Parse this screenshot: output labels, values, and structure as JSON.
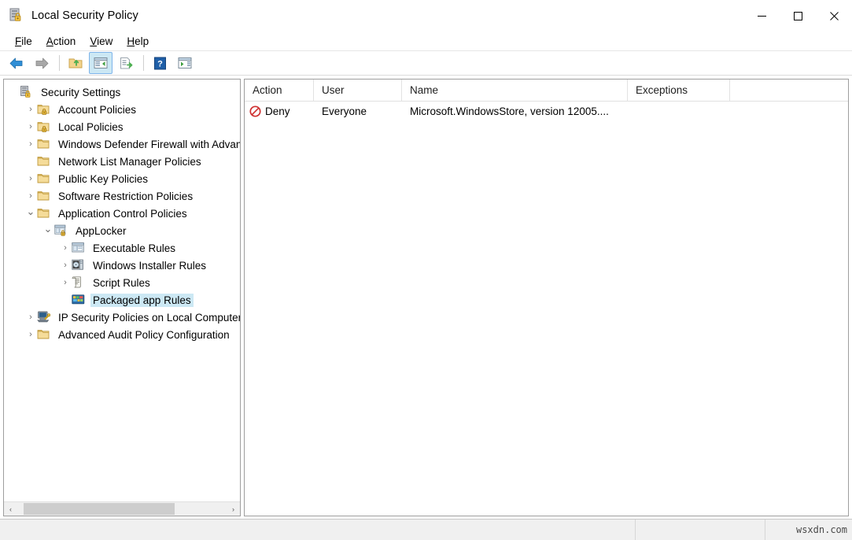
{
  "window": {
    "title": "Local Security Policy",
    "icon": "security-policy-icon",
    "minimize_label": "─",
    "maximize_label": "□",
    "close_label": "✕"
  },
  "menubar": {
    "items": [
      {
        "label": "File",
        "accel": "F"
      },
      {
        "label": "Action",
        "accel": "A"
      },
      {
        "label": "View",
        "accel": "V"
      },
      {
        "label": "Help",
        "accel": "H"
      }
    ]
  },
  "toolbar": {
    "buttons": [
      {
        "name": "back-button",
        "icon": "back-arrow-icon",
        "active": false
      },
      {
        "name": "forward-button",
        "icon": "forward-arrow-icon",
        "active": false
      },
      {
        "name": "up-one-level-button",
        "icon": "folder-up-icon",
        "active": false
      },
      {
        "name": "show-hide-console-tree-button",
        "icon": "console-tree-icon",
        "active": true
      },
      {
        "name": "export-list-button",
        "icon": "export-list-icon",
        "active": false
      },
      {
        "name": "help-button",
        "icon": "help-question-icon",
        "active": false
      },
      {
        "name": "show-hide-action-pane-button",
        "icon": "action-pane-icon",
        "active": false
      }
    ]
  },
  "tree": {
    "root_label": "Security Settings",
    "nodes": [
      {
        "label": "Security Settings",
        "icon": "security-policy-icon",
        "indent": 0,
        "chevron": "",
        "selected": false
      },
      {
        "label": "Account Policies",
        "icon": "folder-lock-icon",
        "indent": 1,
        "chevron": "›",
        "selected": false
      },
      {
        "label": "Local Policies",
        "icon": "folder-lock-icon",
        "indent": 1,
        "chevron": "›",
        "selected": false
      },
      {
        "label": "Windows Defender Firewall with Advanced Security",
        "icon": "folder-icon",
        "indent": 1,
        "chevron": "›",
        "selected": false
      },
      {
        "label": "Network List Manager Policies",
        "icon": "folder-icon",
        "indent": 1,
        "chevron": "",
        "selected": false
      },
      {
        "label": "Public Key Policies",
        "icon": "folder-icon",
        "indent": 1,
        "chevron": "›",
        "selected": false
      },
      {
        "label": "Software Restriction Policies",
        "icon": "folder-icon",
        "indent": 1,
        "chevron": "›",
        "selected": false
      },
      {
        "label": "Application Control Policies",
        "icon": "folder-icon",
        "indent": 1,
        "chevron": "⌄",
        "selected": false
      },
      {
        "label": "AppLocker",
        "icon": "applocker-icon",
        "indent": 2,
        "chevron": "⌄",
        "selected": false
      },
      {
        "label": "Executable Rules",
        "icon": "executable-rules-icon",
        "indent": 3,
        "chevron": "›",
        "selected": false
      },
      {
        "label": "Windows Installer Rules",
        "icon": "windows-installer-rules-icon",
        "indent": 3,
        "chevron": "›",
        "selected": false
      },
      {
        "label": "Script Rules",
        "icon": "script-rules-icon",
        "indent": 3,
        "chevron": "›",
        "selected": false
      },
      {
        "label": "Packaged app Rules",
        "icon": "packaged-app-rules-icon",
        "indent": 3,
        "chevron": "",
        "selected": true
      },
      {
        "label": "IP Security Policies on Local Computer",
        "icon": "ip-security-icon",
        "indent": 1,
        "chevron": "›",
        "selected": false
      },
      {
        "label": "Advanced Audit Policy Configuration",
        "icon": "folder-icon",
        "indent": 1,
        "chevron": "›",
        "selected": false
      }
    ],
    "scrollbar": {
      "left_arrow": "‹",
      "right_arrow": "›"
    }
  },
  "list": {
    "columns": [
      {
        "key": "action",
        "label": "Action"
      },
      {
        "key": "user",
        "label": "User"
      },
      {
        "key": "name",
        "label": "Name"
      },
      {
        "key": "exceptions",
        "label": "Exceptions"
      }
    ],
    "rows": [
      {
        "action": "Deny",
        "action_icon": "deny-icon",
        "user": "Everyone",
        "name": "Microsoft.WindowsStore, version 12005....",
        "exceptions": ""
      }
    ]
  },
  "statusbar": {
    "segment1": "",
    "segment2": "",
    "watermark": "wsxdn.com"
  },
  "colors": {
    "selection": "#cce8f4",
    "deny_red": "#d03030",
    "folder_gold": "#f0c674",
    "accent_blue": "#2a7fd4"
  }
}
